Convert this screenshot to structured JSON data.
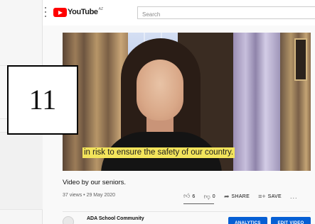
{
  "header": {
    "logo_text": "YouTube",
    "logo_region": "AZ",
    "search_placeholder": "Search"
  },
  "video": {
    "caption": "in risk to ensure the safety of our country.",
    "title": "Video by our seniors.",
    "meta": "37 views • 29 May 2020"
  },
  "actions": {
    "like_count": "6",
    "dislike_count": "0",
    "like_ratio": 1.0,
    "share_label": "SHARE",
    "save_label": "SAVE",
    "more_label": "..."
  },
  "channel": {
    "name": "ADA School Community",
    "analytics_label": "ANALYTICS",
    "edit_label": "EDIT VIDEO"
  },
  "overlay": {
    "number": "11"
  }
}
